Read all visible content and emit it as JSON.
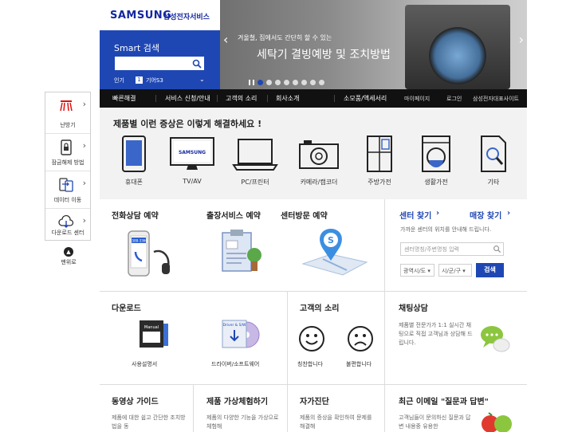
{
  "header": {
    "logo": "SAMSUNG",
    "logo_sub": "삼성전자서비스"
  },
  "smart_search": {
    "title": "Smart 검색",
    "popular_label": "인기",
    "rank": "1",
    "keyword": "기어S3"
  },
  "banner": {
    "small_text": "겨울철, 집에서도 간단히 할 수 있는",
    "big_text": "세탁기 결빙예방 및 조치방법"
  },
  "nav": {
    "items": [
      "빠른해결",
      "서비스 신청/안내",
      "고객의 소리",
      "회사소개",
      "소모품/액세서리"
    ],
    "utils": [
      "마이페이지",
      "로그인",
      "삼성전자대표사이트"
    ]
  },
  "quickbar": {
    "items": [
      "난방기",
      "잠금해제 방법",
      "데이터 이동",
      "다운로드 센터"
    ],
    "top_label": "맨위로"
  },
  "symptom": {
    "title": "제품별 이런 증상은 이렇게 해결하세요 !",
    "categories": [
      "휴대폰",
      "TV/AV",
      "PC/프린터",
      "카메라/캠코더",
      "주방가전",
      "생활가전",
      "기타"
    ],
    "tv_brand": "SAMSUNG"
  },
  "reserve": {
    "phone": "전화상담 예약",
    "visit": "출장서비스 예약",
    "center_visit": "센터방문 예약",
    "phone_number": "1588-3366",
    "center_badge": "S"
  },
  "center": {
    "find_center": "센터 찾기",
    "find_store": "매장 찾기",
    "guide": "가까운 센터의 위치를 안내해 드립니다.",
    "placeholder": "센터명칭/주변명칭 입력",
    "select_city": "광역시/도",
    "select_district": "시/군/구",
    "search_button": "검색"
  },
  "download": {
    "title": "다운로드",
    "manual": "사용설명서",
    "manual_badge": "Manual",
    "driver": "드라이버/소프트웨어",
    "driver_badge": "Driver & S/W"
  },
  "voice": {
    "title": "고객의 소리",
    "praise": "칭찬합니다",
    "complaint": "불편합니다"
  },
  "chat": {
    "title": "채팅상담",
    "text": "제품별 전문가가 1:1 실시간 채팅으로 직접 고객님과 상담해 드립니다."
  },
  "bottom": {
    "video": {
      "title": "동영상 가이드",
      "text": "제품에 대한 쉽고 간단한 조치방법을 동"
    },
    "experience": {
      "title": "제품 가상체험하기",
      "text": "제품의 다양한 기능을 가상으로 체험해"
    },
    "self": {
      "title": "자가진단",
      "text": "제품의 증상을 확인하여 문제를 해결해"
    },
    "qa": {
      "title": "최근 이메일 \"질문과 답변\"",
      "text": "고객님들이 문의하신 질문과 답변 내용중 유용한"
    }
  }
}
